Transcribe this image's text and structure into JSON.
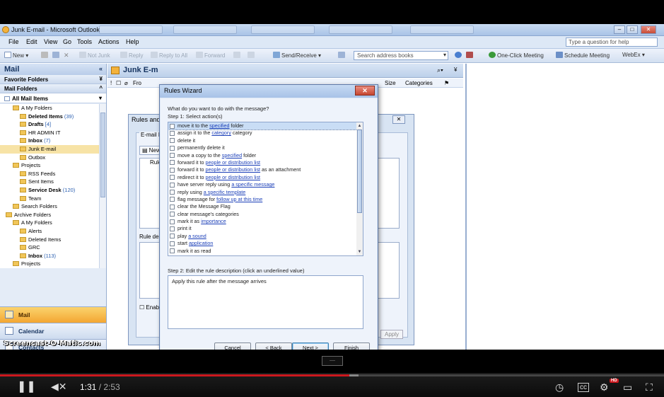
{
  "window": {
    "title": "Junk E-mail - Microsoft Outlook",
    "ask_placeholder": "Type a question for help"
  },
  "menu": [
    "File",
    "Edit",
    "View",
    "Go",
    "Tools",
    "Actions",
    "Help"
  ],
  "toolbar": {
    "new": "New",
    "not_junk": "Not Junk",
    "reply": "Reply",
    "reply_all": "Reply to All",
    "forward": "Forward",
    "send_receive": "Send/Receive",
    "search_address": "Search address books",
    "one_click": "One-Click Meeting",
    "schedule": "Schedule Meeting",
    "webex": "WebEx"
  },
  "nav": {
    "title": "Mail",
    "favorite_folders": "Favorite Folders",
    "mail_folders": "Mail Folders",
    "all_mail_items": "All Mail Items",
    "folders": [
      {
        "label": "A My Folders",
        "count": "",
        "bold": false,
        "indent": 1
      },
      {
        "label": "Deleted Items",
        "count": "(39)",
        "bold": true,
        "indent": 2
      },
      {
        "label": "Drafts",
        "count": "[4]",
        "bold": true,
        "indent": 2
      },
      {
        "label": "HR ADMIN IT",
        "count": "",
        "bold": false,
        "indent": 2
      },
      {
        "label": "Inbox",
        "count": "(7)",
        "bold": true,
        "indent": 2
      },
      {
        "label": "Junk E-mail",
        "count": "",
        "bold": false,
        "indent": 2,
        "selected": true
      },
      {
        "label": "Outbox",
        "count": "",
        "bold": false,
        "indent": 2
      },
      {
        "label": "Projects",
        "count": "",
        "bold": false,
        "indent": 1
      },
      {
        "label": "RSS Feeds",
        "count": "",
        "bold": false,
        "indent": 2
      },
      {
        "label": "Sent Items",
        "count": "",
        "bold": false,
        "indent": 2
      },
      {
        "label": "Service Desk",
        "count": "(120)",
        "bold": true,
        "indent": 2
      },
      {
        "label": "Team",
        "count": "",
        "bold": false,
        "indent": 2
      },
      {
        "label": "Search Folders",
        "count": "",
        "bold": false,
        "indent": 1
      },
      {
        "label": "Archive Folders",
        "count": "",
        "bold": false,
        "indent": 0
      },
      {
        "label": "A My Folders",
        "count": "",
        "bold": false,
        "indent": 1
      },
      {
        "label": "Alerts",
        "count": "",
        "bold": false,
        "indent": 2
      },
      {
        "label": "Deleted Items",
        "count": "",
        "bold": false,
        "indent": 2
      },
      {
        "label": "GRC",
        "count": "",
        "bold": false,
        "indent": 2
      },
      {
        "label": "Inbox",
        "count": "(113)",
        "bold": true,
        "indent": 2
      },
      {
        "label": "Projects",
        "count": "",
        "bold": false,
        "indent": 1
      }
    ],
    "buttons": [
      "Mail",
      "Calendar",
      "Contacts"
    ]
  },
  "content": {
    "header": "Junk E-m",
    "col_size": "Size",
    "col_categories": "Categories",
    "col_from": "Fro"
  },
  "rules_alerts": {
    "title": "Rules and",
    "tab": "E-mail R",
    "new_btn": "New",
    "col_rule": "Rule",
    "rule_desc": "Rule desc",
    "enable": "Enable",
    "apply": "Apply"
  },
  "wizard": {
    "title": "Rules Wizard",
    "question": "What do you want to do with the message?",
    "step1": "Step 1: Select action(s)",
    "step2": "Step 2: Edit the rule description (click an underlined value)",
    "description": "Apply this rule after the message arrives",
    "actions": [
      {
        "pre": "move it to the ",
        "link": "specified",
        "post": " folder",
        "selected": true
      },
      {
        "pre": "assign it to the ",
        "link": "category",
        "post": " category"
      },
      {
        "pre": "delete it",
        "link": "",
        "post": ""
      },
      {
        "pre": "permanently delete it",
        "link": "",
        "post": ""
      },
      {
        "pre": "move a copy to the ",
        "link": "specified",
        "post": " folder"
      },
      {
        "pre": "forward it to ",
        "link": "people or distribution list",
        "post": ""
      },
      {
        "pre": "forward it to ",
        "link": "people or distribution list",
        "post": " as an attachment"
      },
      {
        "pre": "redirect it to ",
        "link": "people or distribution list",
        "post": ""
      },
      {
        "pre": "have server reply using ",
        "link": "a specific message",
        "post": ""
      },
      {
        "pre": "reply using ",
        "link": "a specific template",
        "post": ""
      },
      {
        "pre": "flag message for ",
        "link": "follow up at this time",
        "post": ""
      },
      {
        "pre": "clear the Message Flag",
        "link": "",
        "post": ""
      },
      {
        "pre": "clear message's categories",
        "link": "",
        "post": ""
      },
      {
        "pre": "mark it as ",
        "link": "importance",
        "post": ""
      },
      {
        "pre": "print it",
        "link": "",
        "post": ""
      },
      {
        "pre": "play ",
        "link": "a sound",
        "post": ""
      },
      {
        "pre": "start ",
        "link": "application",
        "post": ""
      },
      {
        "pre": "mark it as read",
        "link": "",
        "post": ""
      }
    ],
    "buttons": {
      "cancel": "Cancel",
      "back": "< Back",
      "next": "Next >",
      "finish": "Finish"
    }
  },
  "watermark": "Screencast-O-Matic.com",
  "player": {
    "current": "1:31",
    "separator": " / ",
    "duration": "2:53",
    "played_fraction": 0.526,
    "loaded_fraction": 0.54,
    "hd": "HD",
    "accent": "#cc181e"
  }
}
